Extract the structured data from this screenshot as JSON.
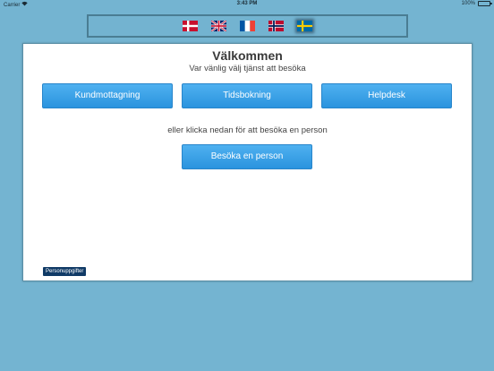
{
  "statusbar": {
    "carrier": "Carrier",
    "wifi_icon": "wifi-icon",
    "time": "3:43 PM",
    "battery": "100%",
    "battery_icon": "battery-icon"
  },
  "languages": [
    {
      "code": "da",
      "icon": "danish-flag-icon",
      "selected": false
    },
    {
      "code": "en",
      "icon": "uk-flag-icon",
      "selected": false
    },
    {
      "code": "fr",
      "icon": "french-flag-icon",
      "selected": false
    },
    {
      "code": "no",
      "icon": "norwegian-flag-icon",
      "selected": false
    },
    {
      "code": "sv",
      "icon": "swedish-flag-icon",
      "selected": true
    }
  ],
  "main": {
    "title": "Välkommen",
    "subtitle": "Var vänlig välj tjänst att besöka",
    "services": [
      {
        "label": "Kundmottagning"
      },
      {
        "label": "Tidsbokning"
      },
      {
        "label": "Helpdesk"
      }
    ],
    "or_text": "eller klicka nedan för att besöka en person",
    "visit_person_label": "Besöka en person",
    "personal_data_label": "Personuppgifter"
  },
  "colors": {
    "background": "#74b4d1",
    "button": "#2f9ae3",
    "dark_button": "#103a66"
  }
}
